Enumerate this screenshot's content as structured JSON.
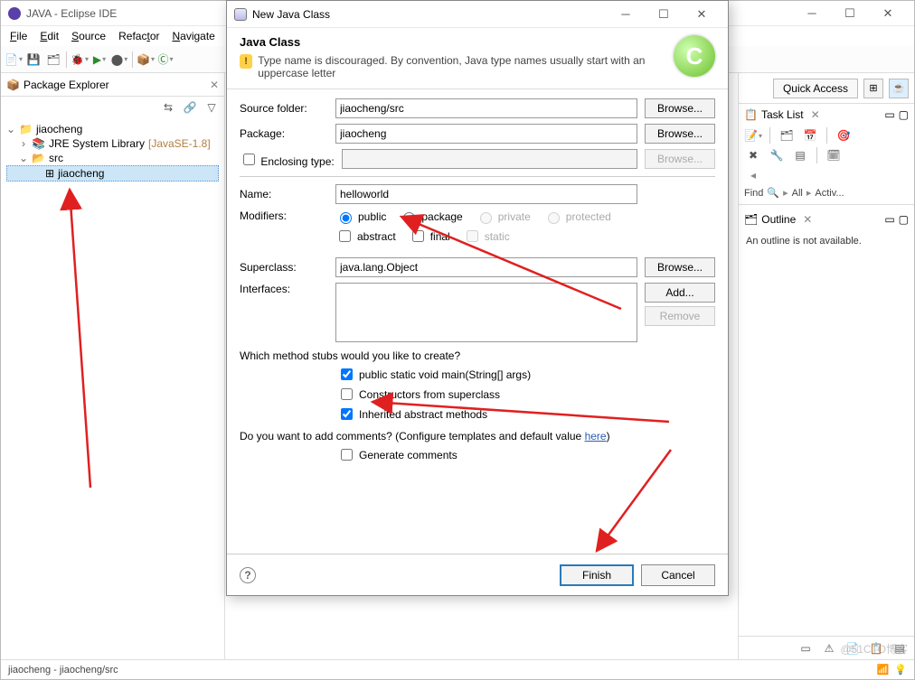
{
  "mainWindow": {
    "title": "JAVA - Eclipse IDE",
    "menu": {
      "file": "File",
      "edit": "Edit",
      "source": "Source",
      "refactor": "Refactor",
      "navigate": "Navigate"
    }
  },
  "packageExplorer": {
    "title": "Package Explorer",
    "tree": {
      "project": "jiaocheng",
      "jre": "JRE System Library",
      "jreVer": "[JavaSE-1.8]",
      "src": "src",
      "pkg": "jiaocheng"
    }
  },
  "quickAccess": "Quick Access",
  "taskList": {
    "title": "Task List",
    "find": "Find",
    "all": "All",
    "activ": "Activ..."
  },
  "outline": {
    "title": "Outline",
    "empty": "An outline is not available."
  },
  "dialog": {
    "winTitle": "New Java Class",
    "heading": "Java Class",
    "warning": "Type name is discouraged. By convention, Java type names usually start with an uppercase letter",
    "labels": {
      "sourceFolder": "Source folder:",
      "package": "Package:",
      "enclosingType": "Enclosing type:",
      "name": "Name:",
      "modifiers": "Modifiers:",
      "superclass": "Superclass:",
      "interfaces": "Interfaces:"
    },
    "values": {
      "sourceFolder": "jiaocheng/src",
      "package": "jiaocheng",
      "name": "helloworld",
      "superclass": "java.lang.Object"
    },
    "modifiers": {
      "public": "public",
      "package": "package",
      "private": "private",
      "protected": "protected",
      "abstract": "abstract",
      "final": "final",
      "static": "static"
    },
    "buttons": {
      "browse": "Browse...",
      "add": "Add...",
      "remove": "Remove",
      "finish": "Finish",
      "cancel": "Cancel"
    },
    "stubsQ": "Which method stubs would you like to create?",
    "stubs": {
      "main": "public static void main(String[] args)",
      "ctor": "Constructors from superclass",
      "inherit": "Inherited abstract methods"
    },
    "commentsQ1": "Do you want to add comments? (Configure templates and default value ",
    "commentsHere": "here",
    "commentsQ2": ")",
    "genComments": "Generate comments"
  },
  "statusbar": "jiaocheng - jiaocheng/src",
  "watermark": "@51CTO博客"
}
